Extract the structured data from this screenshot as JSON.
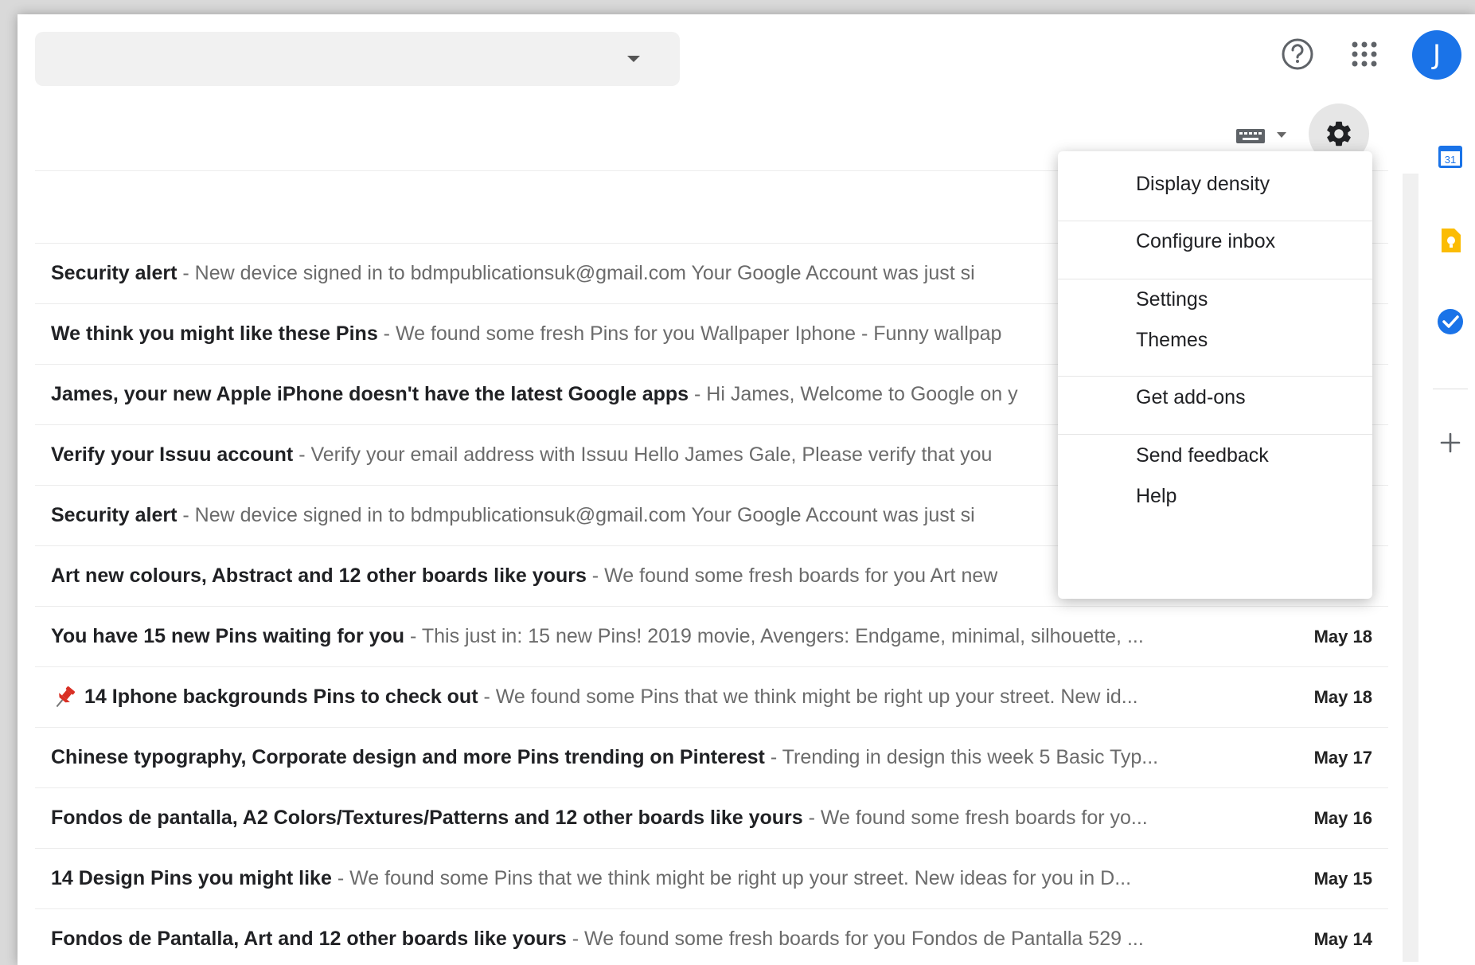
{
  "header": {
    "search": {
      "placeholder": "",
      "value": ""
    },
    "avatar_letter": "J",
    "icons": [
      "help-icon",
      "apps-grid-icon",
      "chevron-down-icon"
    ]
  },
  "toolbar": {
    "icons": [
      "keyboard-icon",
      "gear-icon"
    ]
  },
  "settings_menu": {
    "items": [
      "Display density",
      "Configure inbox",
      "Settings",
      "Themes",
      "Get add-ons",
      "Send feedback",
      "Help"
    ]
  },
  "emails": [
    {
      "sender": "Security alert",
      "snippet": " - New device signed in to bdmpublicationsuk@gmail.com Your Google Account was just si",
      "date": "",
      "pinned": false
    },
    {
      "sender": "We think you might like these Pins",
      "snippet": " - We found some fresh Pins for you Wallpaper Iphone - Funny wallpap",
      "date": "",
      "pinned": false
    },
    {
      "sender": "James, your new Apple iPhone doesn't have the latest Google apps",
      "snippet": " - Hi James, Welcome to Google on y",
      "date": "",
      "pinned": false
    },
    {
      "sender": "Verify your Issuu account",
      "snippet": " - Verify your email address with Issuu Hello James Gale, Please verify that you",
      "date": "",
      "pinned": false
    },
    {
      "sender": "Security alert",
      "snippet": " - New device signed in to bdmpublicationsuk@gmail.com Your Google Account was just si",
      "date": "",
      "pinned": false
    },
    {
      "sender": "Art new colours, Abstract and 12 other boards like yours",
      "snippet": " - We found some fresh boards for you Art new",
      "date": "",
      "pinned": false
    },
    {
      "sender": "You have 15 new Pins waiting for you",
      "snippet": " - This just in: 15 new Pins! 2019 movie, Avengers: Endgame, minimal, silhouette, ...",
      "date": "May 18",
      "pinned": false
    },
    {
      "sender": "14 Iphone backgrounds Pins to check out",
      "snippet": " - We found some Pins that we think might be right up your street. New id...",
      "date": "May 18",
      "pinned": true
    },
    {
      "sender": "Chinese typography, Corporate design and more Pins trending on Pinterest",
      "snippet": " - Trending in design this week 5 Basic Typ...",
      "date": "May 17",
      "pinned": false
    },
    {
      "sender": "Fondos de pantalla, A2 Colors/Textures/Patterns and 12 other boards like yours",
      "snippet": " - We found some fresh boards for yo...",
      "date": "May 16",
      "pinned": false
    },
    {
      "sender": "14 Design Pins you might like",
      "snippet": " - We found some Pins that we think might be right up your street. New ideas for you in D...",
      "date": "May 15",
      "pinned": false
    },
    {
      "sender": "Fondos de Pantalla, Art and 12 other boards like yours",
      "snippet": " - We found some fresh boards for you Fondos de Pantalla 529 ...",
      "date": "May 14",
      "pinned": false
    }
  ],
  "side_panel": {
    "icons": [
      "calendar-icon",
      "keep-icon",
      "tasks-icon",
      "add-icon"
    ],
    "calendar_label": "31"
  },
  "colors": {
    "accent": "#1a73e8",
    "pin_red": "#d93025",
    "keep_yellow": "#fbbc04"
  }
}
